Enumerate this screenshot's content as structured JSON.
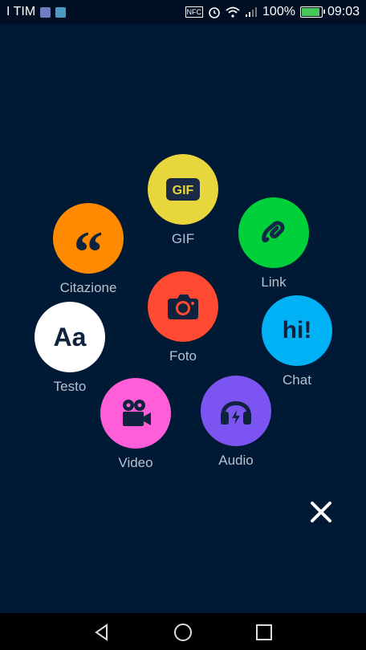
{
  "status_bar": {
    "carrier": "I TIM",
    "nfc": "NFC",
    "battery": "100%",
    "time": "09:03"
  },
  "compose_menu": {
    "options": [
      {
        "key": "gif",
        "label": "GIF",
        "icon": "gif-icon",
        "color": "#e8d63d",
        "icon_text": "GIF"
      },
      {
        "key": "link",
        "label": "Link",
        "icon": "link-icon",
        "color": "#00d13b"
      },
      {
        "key": "chat",
        "label": "Chat",
        "icon": "chat-icon",
        "color": "#00b2f5",
        "icon_text": "hi!"
      },
      {
        "key": "audio",
        "label": "Audio",
        "icon": "headphones-icon",
        "color": "#7b54f2"
      },
      {
        "key": "video",
        "label": "Video",
        "icon": "video-camera-icon",
        "color": "#ff5ed8"
      },
      {
        "key": "text",
        "label": "Testo",
        "icon": "text-icon",
        "color": "#ffffff",
        "icon_text": "Aa"
      },
      {
        "key": "quote",
        "label": "Citazione",
        "icon": "quote-icon",
        "color": "#ff8a00",
        "icon_text": "“"
      },
      {
        "key": "photo",
        "label": "Foto",
        "icon": "camera-icon",
        "color": "#ff4930"
      }
    ],
    "close_icon": "close-icon"
  },
  "nav_bar": {
    "icons": [
      "back-icon",
      "home-icon",
      "recents-icon"
    ]
  }
}
